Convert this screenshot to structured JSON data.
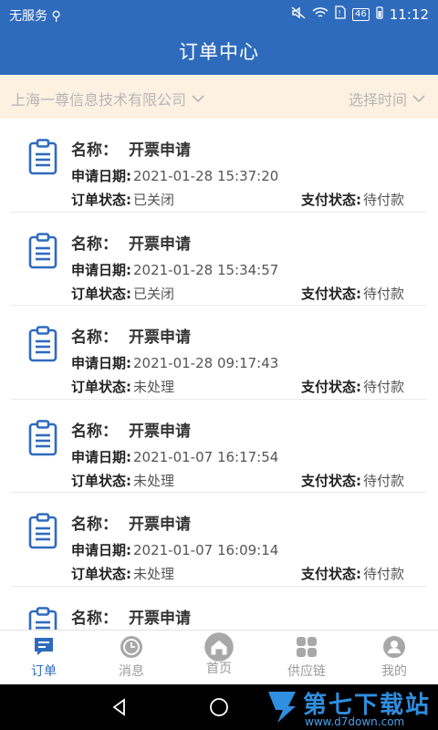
{
  "status_bar": {
    "carrier": "无服务",
    "usb_icon": "usb-icon",
    "battery_badge": "46",
    "time": "11:12"
  },
  "header": {
    "title": "订单中心"
  },
  "filters": {
    "company": "上海一尊信息技术有限公司",
    "time": "选择时间"
  },
  "labels": {
    "name": "名称：",
    "apply_date": "申请日期:",
    "order_status": "订单状态:",
    "pay_status": "支付状态:"
  },
  "orders": [
    {
      "name": "开票申请",
      "date": "2021-01-28 15:37:20",
      "order_status": "已关闭",
      "pay_status": "待付款"
    },
    {
      "name": "开票申请",
      "date": "2021-01-28 15:34:57",
      "order_status": "已关闭",
      "pay_status": "待付款"
    },
    {
      "name": "开票申请",
      "date": "2021-01-28 09:17:43",
      "order_status": "未处理",
      "pay_status": "待付款"
    },
    {
      "name": "开票申请",
      "date": "2021-01-07 16:17:54",
      "order_status": "未处理",
      "pay_status": "待付款"
    },
    {
      "name": "开票申请",
      "date": "2021-01-07 16:09:14",
      "order_status": "未处理",
      "pay_status": "待付款"
    },
    {
      "name": "开票申请",
      "date": "",
      "order_status": "",
      "pay_status": ""
    }
  ],
  "tabs": [
    {
      "label": "订单",
      "icon": "order-icon",
      "active": true
    },
    {
      "label": "消息",
      "icon": "clock-icon",
      "active": false
    },
    {
      "label": "首页",
      "icon": "home-icon",
      "active": false
    },
    {
      "label": "供应链",
      "icon": "grid-icon",
      "active": false
    },
    {
      "label": "我的",
      "icon": "user-icon",
      "active": false
    }
  ],
  "colors": {
    "primary": "#2f6bbd",
    "filter_bg": "#fdf1e2",
    "tab_inactive": "#9a9a9a"
  },
  "watermark": {
    "title": "第七下载站",
    "url": "www.d7down.com"
  }
}
